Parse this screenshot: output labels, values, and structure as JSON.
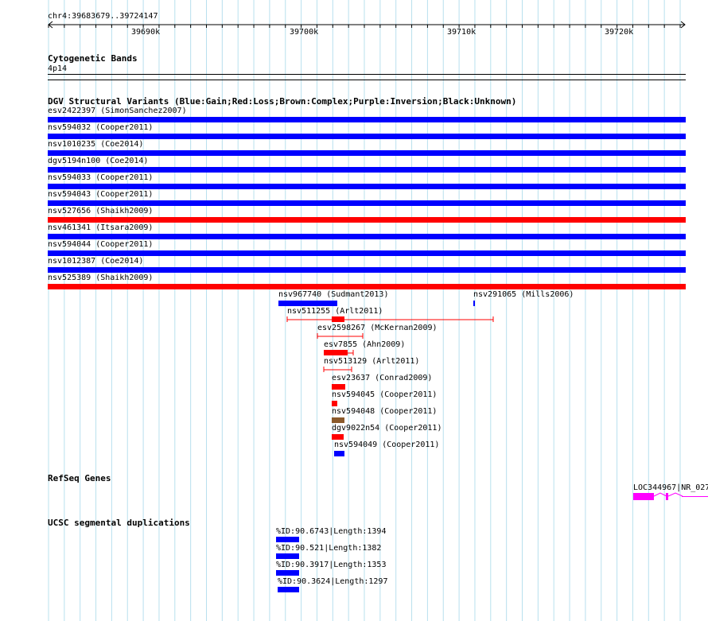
{
  "ruler": {
    "position": "chr4:39683679..39724147",
    "ticks": [
      "39690k",
      "39700k",
      "39710k",
      "39720k"
    ]
  },
  "cytoband": {
    "title": "Cytogenetic Bands",
    "band": "4p14"
  },
  "dgv": {
    "title": "DGV Structural Variants (Blue:Gain;Red:Loss;Brown:Complex;Purple:Inversion;Black:Unknown)",
    "colors": {
      "gain": "#0000ff",
      "loss": "#ff0000",
      "complex": "#8b5a2b",
      "unknown": "#000000"
    },
    "full_rows": [
      {
        "label": "esv2422397 (SimonSanchez2007)",
        "type": "gain"
      },
      {
        "label": "nsv594032 (Cooper2011)",
        "type": "gain"
      },
      {
        "label": "nsv1010235 (Coe2014)",
        "type": "gain"
      },
      {
        "label": "dgv5194n100 (Coe2014)",
        "type": "gain"
      },
      {
        "label": "nsv594033 (Cooper2011)",
        "type": "gain"
      },
      {
        "label": "nsv594043 (Cooper2011)",
        "type": "gain"
      },
      {
        "label": "nsv527656 (Shaikh2009)",
        "type": "loss"
      },
      {
        "label": "nsv461341 (Itsara2009)",
        "type": "gain"
      },
      {
        "label": "nsv594044 (Cooper2011)",
        "type": "gain"
      },
      {
        "label": "nsv1012387 (Coe2014)",
        "type": "gain"
      },
      {
        "label": "nsv525389 (Shaikh2009)",
        "type": "loss"
      }
    ],
    "partial": [
      {
        "label": "nsv967740 (Sudmant2013)",
        "type": "gain"
      },
      {
        "label": "nsv291065 (Mills2006)",
        "type": "gain"
      },
      {
        "label": "nsv511255 (Arlt2011)",
        "type": "loss"
      },
      {
        "label": "esv2598267 (McKernan2009)",
        "type": "loss"
      },
      {
        "label": "esv7855 (Ahn2009)",
        "type": "loss"
      },
      {
        "label": "nsv513129 (Arlt2011)",
        "type": "loss"
      },
      {
        "label": "esv23637 (Conrad2009)",
        "type": "loss"
      },
      {
        "label": "nsv594045 (Cooper2011)",
        "type": "loss"
      },
      {
        "label": "nsv594048 (Cooper2011)",
        "type": "complex"
      },
      {
        "label": "dgv9022n54 (Cooper2011)",
        "type": "loss"
      },
      {
        "label": "nsv594049 (Cooper2011)",
        "type": "gain"
      }
    ]
  },
  "refseq": {
    "title": "RefSeq Genes",
    "gene_label": "LOC344967|NR_027",
    "color": "#ff00ff"
  },
  "segdup": {
    "title": "UCSC segmental duplications",
    "items": [
      {
        "label": "%ID:90.6743|Length:1394"
      },
      {
        "label": "%ID:90.521|Length:1382"
      },
      {
        "label": "%ID:90.3917|Length:1353"
      },
      {
        "label": "%ID:90.3624|Length:1297"
      }
    ],
    "color": "#0000ff"
  }
}
